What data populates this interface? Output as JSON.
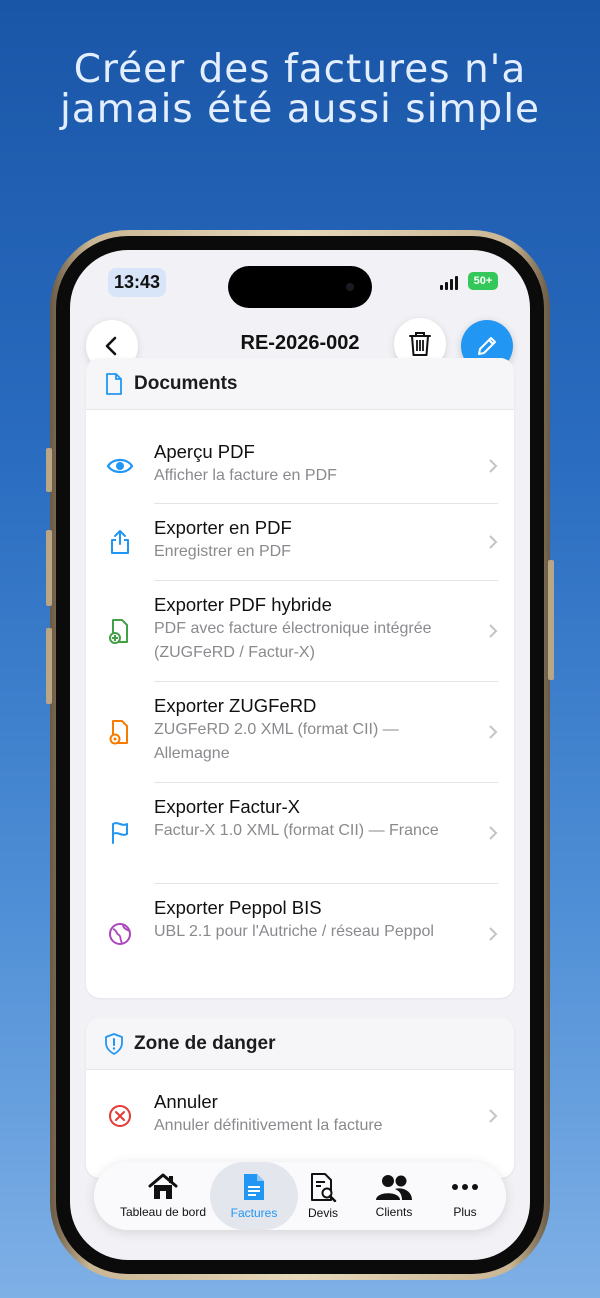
{
  "headline": {
    "line1": "Créer des factures n'a",
    "line2": "jamais été aussi simple"
  },
  "status_bar": {
    "time": "13:43",
    "battery": "50+"
  },
  "nav": {
    "title": "RE-2026-002"
  },
  "documents": {
    "title": "Documents",
    "items": [
      {
        "title": "Aperçu PDF",
        "subtitle": "Afficher la facture en PDF",
        "icon": "eye-icon"
      },
      {
        "title": "Exporter en PDF",
        "subtitle": "Enregistrer en PDF",
        "icon": "share-icon"
      },
      {
        "title": "Exporter PDF hybride",
        "subtitle": "PDF avec facture électronique intégrée (ZUGFeRD / Factur-X)",
        "icon": "file-plus-icon"
      },
      {
        "title": "Exporter ZUGFeRD",
        "subtitle": "ZUGFeRD 2.0 XML (format CII) — Allemagne",
        "icon": "file-settings-icon"
      },
      {
        "title": "Exporter Factur-X",
        "subtitle": "Factur-X 1.0 XML (format CII) — France",
        "icon": "flag-icon"
      },
      {
        "title": "Exporter Peppol BIS",
        "subtitle": "UBL 2.1 pour l'Autriche / réseau Peppol",
        "icon": "globe-icon"
      }
    ]
  },
  "danger_zone": {
    "title": "Zone de danger",
    "items": [
      {
        "title": "Annuler",
        "subtitle": "Annuler définitivement la facture",
        "icon": "x-circle-icon"
      }
    ]
  },
  "tabs": [
    {
      "label": "Tableau de bord",
      "icon": "home-icon"
    },
    {
      "label": "Factures",
      "icon": "document-icon",
      "active": true
    },
    {
      "label": "Devis",
      "icon": "document-search-icon"
    },
    {
      "label": "Clients",
      "icon": "people-icon"
    },
    {
      "label": "Plus",
      "icon": "more-icon"
    }
  ],
  "colors": {
    "accent": "#2196f3",
    "danger": "#e53935",
    "hybrid": "#43a047",
    "zugferd": "#f57c00",
    "peppol": "#ab47bc",
    "background_top": "#1a56a8",
    "background_bottom": "#7fb0e6"
  }
}
